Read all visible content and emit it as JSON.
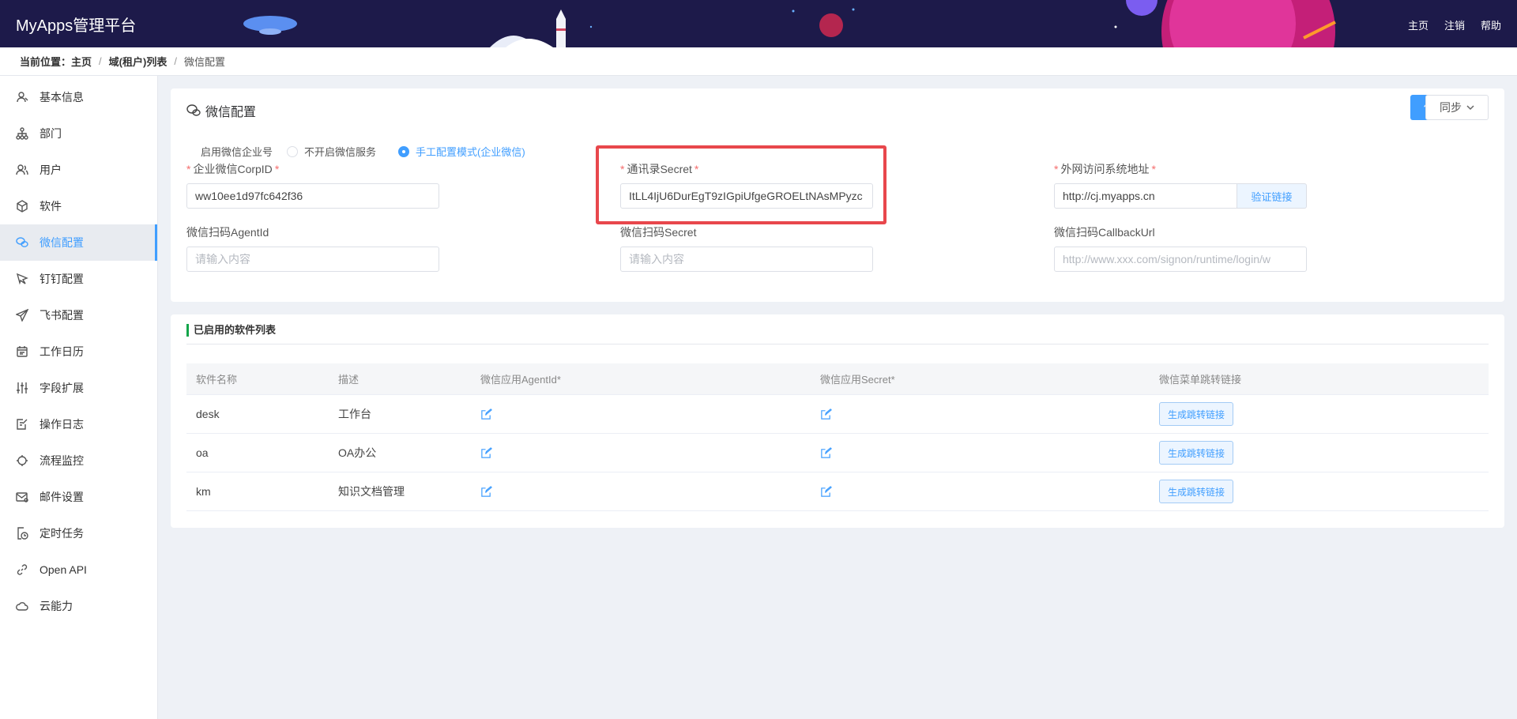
{
  "header": {
    "brand": "MyApps管理平台",
    "nav": {
      "home": "主页",
      "logout": "注销",
      "help": "帮助"
    }
  },
  "breadcrumb": {
    "lead": "当前位置：",
    "items": [
      "主页",
      "域(租户)列表",
      "微信配置"
    ]
  },
  "sidebar": {
    "items": [
      {
        "label": "基本信息",
        "icon": "user-info-icon"
      },
      {
        "label": "部门",
        "icon": "org-tree-icon"
      },
      {
        "label": "用户",
        "icon": "users-icon"
      },
      {
        "label": "软件",
        "icon": "cube-icon"
      },
      {
        "label": "微信配置",
        "icon": "wechat-icon",
        "active": true
      },
      {
        "label": "钉钉配置",
        "icon": "dingtalk-icon"
      },
      {
        "label": "飞书配置",
        "icon": "paper-plane-icon"
      },
      {
        "label": "工作日历",
        "icon": "calendar-icon"
      },
      {
        "label": "字段扩展",
        "icon": "sliders-icon"
      },
      {
        "label": "操作日志",
        "icon": "log-icon"
      },
      {
        "label": "流程监控",
        "icon": "monitor-icon"
      },
      {
        "label": "邮件设置",
        "icon": "mail-icon"
      },
      {
        "label": "定时任务",
        "icon": "timer-task-icon"
      },
      {
        "label": "Open API",
        "icon": "link-icon"
      },
      {
        "label": "云能力",
        "icon": "cloud-icon"
      }
    ]
  },
  "config": {
    "title": "微信配置",
    "save_label": "保存",
    "sync_label": "同步",
    "enable_label": "启用微信企业号",
    "radio_off": "不开启微信服务",
    "radio_manual": "手工配置模式(企业微信)",
    "corp_id": {
      "label": "企业微信CorpID",
      "value": "ww10ee1d97fc642f36"
    },
    "contacts_secret": {
      "label": "通讯录Secret",
      "value": "ItLL4IjU6DurEgT9zIGpiUfgeGROELtNAsMPyzc"
    },
    "external_url": {
      "label": "外网访问系统地址",
      "value": "http://cj.myapps.cn",
      "verify_label": "验证链接"
    },
    "scan_agent_id": {
      "label": "微信扫码AgentId",
      "placeholder": "请输入内容"
    },
    "scan_secret": {
      "label": "微信扫码Secret",
      "placeholder": "请输入内容"
    },
    "callback_url": {
      "label": "微信扫码CallbackUrl",
      "placeholder": "http://www.xxx.com/signon/runtime/login/w"
    }
  },
  "apps": {
    "title": "已启用的软件列表",
    "columns": [
      "软件名称",
      "描述",
      "微信应用AgentId*",
      "微信应用Secret*",
      "微信菜单跳转链接"
    ],
    "gen_label": "生成跳转链接",
    "rows": [
      {
        "name": "desk",
        "desc": "工作台"
      },
      {
        "name": "oa",
        "desc": "OA办公"
      },
      {
        "name": "km",
        "desc": "知识文档管理"
      }
    ]
  },
  "colors": {
    "accent": "#409eff",
    "header_bg": "#1d1a4a",
    "highlight": "#e8474c",
    "title_bar": "#13a54a"
  }
}
